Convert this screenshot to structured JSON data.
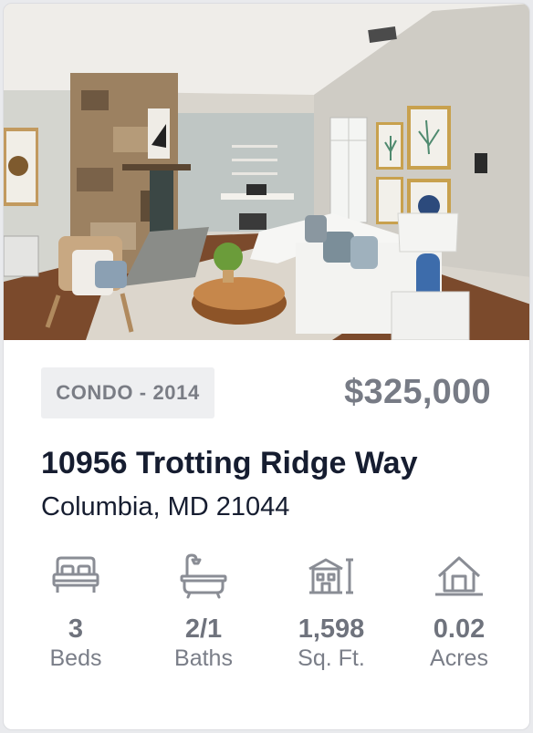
{
  "listing": {
    "type_badge": "CONDO - 2014",
    "price": "$325,000",
    "street": "10956 Trotting Ridge Way",
    "city_state_zip": "Columbia, MD 21044",
    "photo_alt": "Living room photo"
  },
  "stats": [
    {
      "icon": "bed-icon",
      "value": "3",
      "label": "Beds"
    },
    {
      "icon": "bathtub-icon",
      "value": "2/1",
      "label": "Baths"
    },
    {
      "icon": "building-icon",
      "value": "1,598",
      "label": "Sq. Ft."
    },
    {
      "icon": "house-icon",
      "value": "0.02",
      "label": "Acres"
    }
  ],
  "colors": {
    "title": "#161d30",
    "price": "#777b85",
    "muted": "#7a7e88",
    "badge_bg": "#eeeff1",
    "icon": "#8a8d95"
  }
}
